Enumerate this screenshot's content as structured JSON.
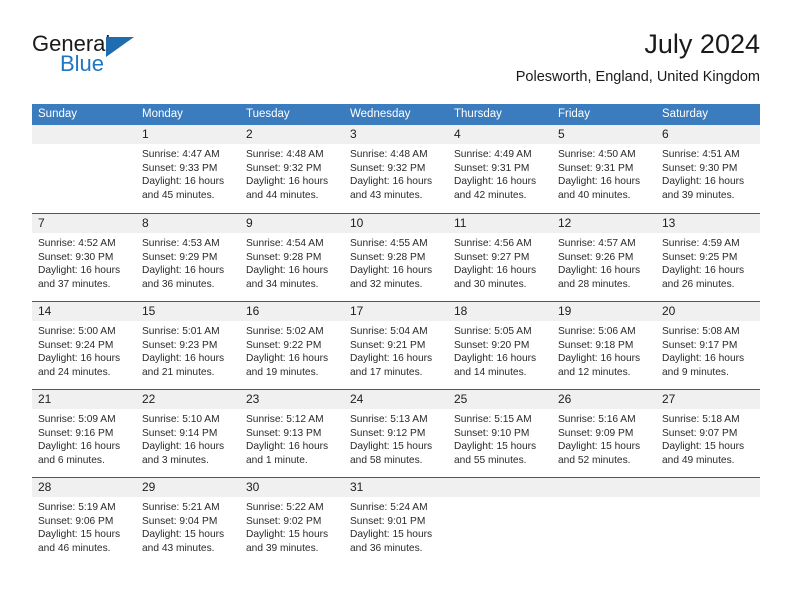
{
  "brand": {
    "word1": "General",
    "word2": "Blue",
    "triangle_color": "#1f6cb0"
  },
  "header": {
    "title": "July 2024",
    "location": "Polesworth, England, United Kingdom",
    "accent_color": "#3a7cbe",
    "rule_color": "#2a6099",
    "daynum_band_color": "#f0f0f0"
  },
  "calendar": {
    "weekdays": [
      "Sunday",
      "Monday",
      "Tuesday",
      "Wednesday",
      "Thursday",
      "Friday",
      "Saturday"
    ],
    "weeks": [
      [
        {
          "day": "",
          "sunrise": "",
          "sunset": "",
          "daylight1": "",
          "daylight2": ""
        },
        {
          "day": "1",
          "sunrise": "Sunrise: 4:47 AM",
          "sunset": "Sunset: 9:33 PM",
          "daylight1": "Daylight: 16 hours",
          "daylight2": "and 45 minutes."
        },
        {
          "day": "2",
          "sunrise": "Sunrise: 4:48 AM",
          "sunset": "Sunset: 9:32 PM",
          "daylight1": "Daylight: 16 hours",
          "daylight2": "and 44 minutes."
        },
        {
          "day": "3",
          "sunrise": "Sunrise: 4:48 AM",
          "sunset": "Sunset: 9:32 PM",
          "daylight1": "Daylight: 16 hours",
          "daylight2": "and 43 minutes."
        },
        {
          "day": "4",
          "sunrise": "Sunrise: 4:49 AM",
          "sunset": "Sunset: 9:31 PM",
          "daylight1": "Daylight: 16 hours",
          "daylight2": "and 42 minutes."
        },
        {
          "day": "5",
          "sunrise": "Sunrise: 4:50 AM",
          "sunset": "Sunset: 9:31 PM",
          "daylight1": "Daylight: 16 hours",
          "daylight2": "and 40 minutes."
        },
        {
          "day": "6",
          "sunrise": "Sunrise: 4:51 AM",
          "sunset": "Sunset: 9:30 PM",
          "daylight1": "Daylight: 16 hours",
          "daylight2": "and 39 minutes."
        }
      ],
      [
        {
          "day": "7",
          "sunrise": "Sunrise: 4:52 AM",
          "sunset": "Sunset: 9:30 PM",
          "daylight1": "Daylight: 16 hours",
          "daylight2": "and 37 minutes."
        },
        {
          "day": "8",
          "sunrise": "Sunrise: 4:53 AM",
          "sunset": "Sunset: 9:29 PM",
          "daylight1": "Daylight: 16 hours",
          "daylight2": "and 36 minutes."
        },
        {
          "day": "9",
          "sunrise": "Sunrise: 4:54 AM",
          "sunset": "Sunset: 9:28 PM",
          "daylight1": "Daylight: 16 hours",
          "daylight2": "and 34 minutes."
        },
        {
          "day": "10",
          "sunrise": "Sunrise: 4:55 AM",
          "sunset": "Sunset: 9:28 PM",
          "daylight1": "Daylight: 16 hours",
          "daylight2": "and 32 minutes."
        },
        {
          "day": "11",
          "sunrise": "Sunrise: 4:56 AM",
          "sunset": "Sunset: 9:27 PM",
          "daylight1": "Daylight: 16 hours",
          "daylight2": "and 30 minutes."
        },
        {
          "day": "12",
          "sunrise": "Sunrise: 4:57 AM",
          "sunset": "Sunset: 9:26 PM",
          "daylight1": "Daylight: 16 hours",
          "daylight2": "and 28 minutes."
        },
        {
          "day": "13",
          "sunrise": "Sunrise: 4:59 AM",
          "sunset": "Sunset: 9:25 PM",
          "daylight1": "Daylight: 16 hours",
          "daylight2": "and 26 minutes."
        }
      ],
      [
        {
          "day": "14",
          "sunrise": "Sunrise: 5:00 AM",
          "sunset": "Sunset: 9:24 PM",
          "daylight1": "Daylight: 16 hours",
          "daylight2": "and 24 minutes."
        },
        {
          "day": "15",
          "sunrise": "Sunrise: 5:01 AM",
          "sunset": "Sunset: 9:23 PM",
          "daylight1": "Daylight: 16 hours",
          "daylight2": "and 21 minutes."
        },
        {
          "day": "16",
          "sunrise": "Sunrise: 5:02 AM",
          "sunset": "Sunset: 9:22 PM",
          "daylight1": "Daylight: 16 hours",
          "daylight2": "and 19 minutes."
        },
        {
          "day": "17",
          "sunrise": "Sunrise: 5:04 AM",
          "sunset": "Sunset: 9:21 PM",
          "daylight1": "Daylight: 16 hours",
          "daylight2": "and 17 minutes."
        },
        {
          "day": "18",
          "sunrise": "Sunrise: 5:05 AM",
          "sunset": "Sunset: 9:20 PM",
          "daylight1": "Daylight: 16 hours",
          "daylight2": "and 14 minutes."
        },
        {
          "day": "19",
          "sunrise": "Sunrise: 5:06 AM",
          "sunset": "Sunset: 9:18 PM",
          "daylight1": "Daylight: 16 hours",
          "daylight2": "and 12 minutes."
        },
        {
          "day": "20",
          "sunrise": "Sunrise: 5:08 AM",
          "sunset": "Sunset: 9:17 PM",
          "daylight1": "Daylight: 16 hours",
          "daylight2": "and 9 minutes."
        }
      ],
      [
        {
          "day": "21",
          "sunrise": "Sunrise: 5:09 AM",
          "sunset": "Sunset: 9:16 PM",
          "daylight1": "Daylight: 16 hours",
          "daylight2": "and 6 minutes."
        },
        {
          "day": "22",
          "sunrise": "Sunrise: 5:10 AM",
          "sunset": "Sunset: 9:14 PM",
          "daylight1": "Daylight: 16 hours",
          "daylight2": "and 3 minutes."
        },
        {
          "day": "23",
          "sunrise": "Sunrise: 5:12 AM",
          "sunset": "Sunset: 9:13 PM",
          "daylight1": "Daylight: 16 hours",
          "daylight2": "and 1 minute."
        },
        {
          "day": "24",
          "sunrise": "Sunrise: 5:13 AM",
          "sunset": "Sunset: 9:12 PM",
          "daylight1": "Daylight: 15 hours",
          "daylight2": "and 58 minutes."
        },
        {
          "day": "25",
          "sunrise": "Sunrise: 5:15 AM",
          "sunset": "Sunset: 9:10 PM",
          "daylight1": "Daylight: 15 hours",
          "daylight2": "and 55 minutes."
        },
        {
          "day": "26",
          "sunrise": "Sunrise: 5:16 AM",
          "sunset": "Sunset: 9:09 PM",
          "daylight1": "Daylight: 15 hours",
          "daylight2": "and 52 minutes."
        },
        {
          "day": "27",
          "sunrise": "Sunrise: 5:18 AM",
          "sunset": "Sunset: 9:07 PM",
          "daylight1": "Daylight: 15 hours",
          "daylight2": "and 49 minutes."
        }
      ],
      [
        {
          "day": "28",
          "sunrise": "Sunrise: 5:19 AM",
          "sunset": "Sunset: 9:06 PM",
          "daylight1": "Daylight: 15 hours",
          "daylight2": "and 46 minutes."
        },
        {
          "day": "29",
          "sunrise": "Sunrise: 5:21 AM",
          "sunset": "Sunset: 9:04 PM",
          "daylight1": "Daylight: 15 hours",
          "daylight2": "and 43 minutes."
        },
        {
          "day": "30",
          "sunrise": "Sunrise: 5:22 AM",
          "sunset": "Sunset: 9:02 PM",
          "daylight1": "Daylight: 15 hours",
          "daylight2": "and 39 minutes."
        },
        {
          "day": "31",
          "sunrise": "Sunrise: 5:24 AM",
          "sunset": "Sunset: 9:01 PM",
          "daylight1": "Daylight: 15 hours",
          "daylight2": "and 36 minutes."
        },
        {
          "day": "",
          "sunrise": "",
          "sunset": "",
          "daylight1": "",
          "daylight2": ""
        },
        {
          "day": "",
          "sunrise": "",
          "sunset": "",
          "daylight1": "",
          "daylight2": ""
        },
        {
          "day": "",
          "sunrise": "",
          "sunset": "",
          "daylight1": "",
          "daylight2": ""
        }
      ]
    ]
  }
}
